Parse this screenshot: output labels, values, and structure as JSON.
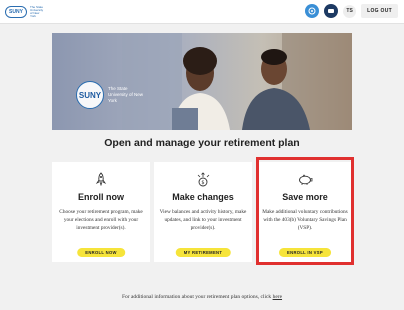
{
  "header": {
    "logo_text": "SUNY",
    "logo_subtext": "The State University of New York",
    "user_initials": "TS",
    "logout_label": "LOG OUT",
    "help_icon": "help-icon",
    "chat_icon": "chat-icon"
  },
  "hero": {
    "badge_text": "SUNY",
    "university_text": "The State University of New York"
  },
  "headline": "Open and manage your retirement plan",
  "cards": [
    {
      "icon": "rocket-icon",
      "title": "Enroll now",
      "description": "Choose your retirement program, make your elections and enroll with your investment provider(s).",
      "button": "ENROLL NOW"
    },
    {
      "icon": "dollar-arrows-icon",
      "title": "Make changes",
      "description": "View balances and activity history, make updates, and link to your investment provider(s).",
      "button": "MY RETIREMENT"
    },
    {
      "icon": "piggy-bank-icon",
      "title": "Save more",
      "description": "Make additional voluntary contributions with the 403(b) Voluntary Savings Plan (VSP).",
      "button": "ENROLL IN VSP"
    }
  ],
  "footnote": {
    "text": "For additional information about your retirement plan options, click",
    "link": "here"
  },
  "colors": {
    "accent_yellow": "#f6e43a",
    "highlight_red": "#e0302f",
    "brand_blue": "#2a6db0"
  }
}
